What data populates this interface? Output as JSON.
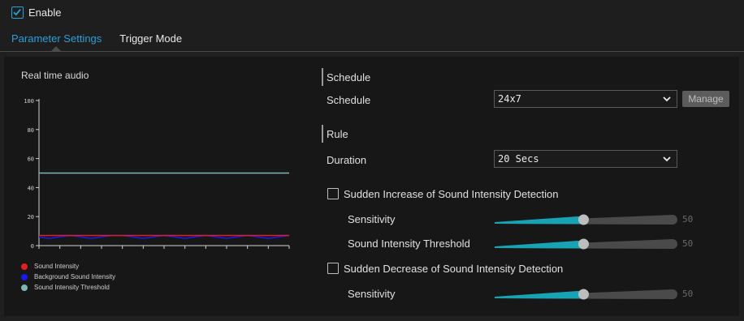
{
  "enable": {
    "label": "Enable",
    "checked": true
  },
  "tabs": [
    {
      "label": "Parameter Settings",
      "active": true
    },
    {
      "label": "Trigger Mode",
      "active": false
    }
  ],
  "chart": {
    "title": "Real time audio",
    "legend": [
      {
        "name": "Sound Intensity",
        "color": "#e02020"
      },
      {
        "name": "Background Sound Intensity",
        "color": "#1a1af0"
      },
      {
        "name": "Sound Intensity Threshold",
        "color": "#7ab8b8"
      }
    ]
  },
  "chart_data": {
    "type": "line",
    "title": "Real time audio",
    "xlabel": "",
    "ylabel": "",
    "ylim": [
      0,
      100
    ],
    "yticks": [
      0,
      20,
      40,
      60,
      80,
      100
    ],
    "x_tick_count": 12,
    "grid": false,
    "series": [
      {
        "name": "Sound Intensity",
        "color": "#e02020",
        "values": [
          7,
          7,
          7,
          7,
          7,
          7,
          7,
          7,
          7,
          7,
          7,
          7,
          7,
          7,
          7,
          7,
          7,
          7,
          7,
          7,
          7,
          7,
          7,
          7,
          7
        ]
      },
      {
        "name": "Background Sound Intensity",
        "color": "#1a1af0",
        "values": [
          6,
          5,
          6,
          7,
          6,
          5,
          6,
          7,
          7,
          6,
          5,
          6,
          7,
          6,
          5,
          6,
          7,
          6,
          5,
          6,
          7,
          6,
          5,
          6,
          7
        ]
      },
      {
        "name": "Sound Intensity Threshold",
        "color": "#7ab8b8",
        "values": [
          50,
          50,
          50,
          50,
          50,
          50,
          50,
          50,
          50,
          50,
          50,
          50,
          50,
          50,
          50,
          50,
          50,
          50,
          50,
          50,
          50,
          50,
          50,
          50,
          50
        ]
      }
    ]
  },
  "schedule": {
    "section_title": "Schedule",
    "label": "Schedule",
    "value": "24x7",
    "manage_label": "Manage"
  },
  "rule": {
    "section_title": "Rule",
    "duration_label": "Duration",
    "duration_value": "20 Secs"
  },
  "sudden_increase": {
    "label": "Sudden Increase of Sound Intensity Detection",
    "checked": false,
    "sensitivity_label": "Sensitivity",
    "sensitivity_value": "50",
    "sensitivity_fraction": 0.5,
    "threshold_label": "Sound Intensity Threshold",
    "threshold_value": "50",
    "threshold_fraction": 0.5
  },
  "sudden_decrease": {
    "label": "Sudden Decrease of Sound Intensity Detection",
    "checked": false,
    "sensitivity_label": "Sensitivity",
    "sensitivity_value": "50",
    "sensitivity_fraction": 0.5
  },
  "colors": {
    "accent": "#2a9fd8",
    "slider_fill": "#17a3b3",
    "slider_track": "#4a4a4a",
    "knob": "#bdbdbd"
  }
}
